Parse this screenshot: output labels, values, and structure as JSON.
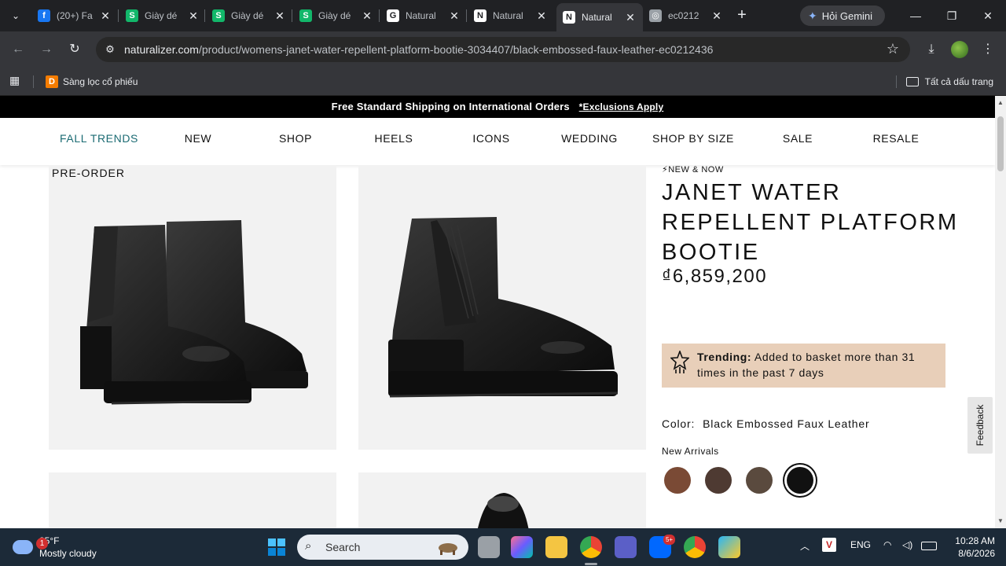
{
  "browser": {
    "tabs": [
      {
        "title": "(20+) Fa",
        "favicon": "facebook-icon",
        "color": "#1877f2",
        "glyph": "f"
      },
      {
        "title": "Giày dé",
        "favicon": "s-app-icon",
        "color": "#12b76a",
        "glyph": "S"
      },
      {
        "title": "Giày dé",
        "favicon": "s-app-icon",
        "color": "#12b76a",
        "glyph": "S"
      },
      {
        "title": "Giày dé",
        "favicon": "s-app-icon",
        "color": "#12b76a",
        "glyph": "S"
      },
      {
        "title": "Natural",
        "favicon": "google-icon",
        "color": "#ffffff",
        "glyph": "G"
      },
      {
        "title": "Natural",
        "favicon": "naturalizer-icon",
        "color": "#ffffff",
        "glyph": "N"
      },
      {
        "title": "Natural",
        "favicon": "naturalizer-icon",
        "color": "#ffffff",
        "glyph": "N",
        "active": true
      },
      {
        "title": "ec0212",
        "favicon": "globe-icon",
        "color": "#9aa0a6",
        "glyph": "◎"
      }
    ],
    "new_tab_label": "+",
    "gemini_label": "Hỏi Gemini",
    "window_controls": {
      "minimize": "—",
      "restore": "❐",
      "close": "✕"
    },
    "url_host": "naturalizer.com",
    "url_path": "/product/womens-janet-water-repellent-platform-bootie-3034407/black-embossed-faux-leather-ec0212436",
    "bookmark_item": "Sàng lọc cổ phiếu",
    "bookmark_item_glyph": "D",
    "bookmarks_all": "Tất cả dấu trang"
  },
  "site": {
    "promo_text": "Free Standard Shipping on International Orders",
    "promo_link": "*Exclusions Apply",
    "nav": [
      "FALL TRENDS",
      "NEW",
      "SHOP",
      "HEELS",
      "ICONS",
      "WEDDING",
      "SHOP BY SIZE",
      "SALE",
      "RESALE"
    ],
    "nav_highlight_color": "#1b6b73"
  },
  "product": {
    "preorder_label": "PRE-ORDER",
    "badge": "⚡NEW & NOW",
    "title": "JANET WATER REPELLENT PLATFORM BOOTIE",
    "price": "₫6,859,200",
    "trending_label": "Trending:",
    "trending_text": "Added to basket more than 31 times in the past 7 days",
    "trending_bg": "#e8cfb9",
    "color_label": "Color:",
    "color_value": "Black Embossed Faux Leather",
    "arrivals_label": "New Arrivals",
    "swatches": [
      {
        "name": "brown-swatch",
        "color": "#7a4a35"
      },
      {
        "name": "dark-brown-swatch",
        "color": "#4e3a32"
      },
      {
        "name": "taupe-swatch",
        "color": "#5a4a3e"
      },
      {
        "name": "black-swatch",
        "color": "#111111",
        "selected": true
      }
    ],
    "feedback_label": "Feedback"
  },
  "taskbar": {
    "weather_temp": "85°F",
    "weather_desc": "Mostly cloudy",
    "weather_badge": "1",
    "search_label": "Search",
    "zalo_badge": "5+",
    "lang": "ENG",
    "time": "10:28 AM",
    "date": "8/6/2026"
  }
}
